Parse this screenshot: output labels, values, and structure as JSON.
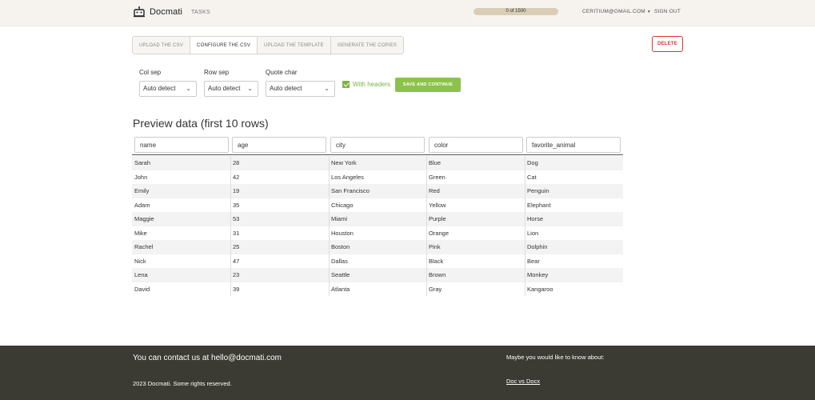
{
  "header": {
    "logo_text": "Docmati",
    "nav_tasks": "TASKS",
    "usage_text": "0 of 1500",
    "usage_fraction": 0,
    "user_email": "CERITIUM@GMAIL.COM",
    "sign_out": "SIGN OUT"
  },
  "tabs": [
    {
      "label": "UPLOAD THE CSV"
    },
    {
      "label": "CONFIGURE THE CSV"
    },
    {
      "label": "UPLOAD THE TEMPLATE"
    },
    {
      "label": "GENERATE THE COPIES"
    }
  ],
  "delete_label": "DELETE",
  "config": {
    "col_sep": {
      "label": "Col sep",
      "value": "Auto detect"
    },
    "row_sep": {
      "label": "Row sep",
      "value": "Auto detect"
    },
    "quote_char": {
      "label": "Quote char",
      "value": "Auto detect"
    },
    "with_headers": "With headers",
    "save_label": "SAVE AND CONTINUE"
  },
  "preview": {
    "title": "Preview data (first 10 rows)",
    "columns": [
      "name",
      "age",
      "city",
      "color",
      "favorite_animal"
    ],
    "rows": [
      [
        "Sarah",
        "28",
        "New York",
        "Blue",
        "Dog"
      ],
      [
        "John",
        "42",
        "Los Angeles",
        "Green",
        "Cat"
      ],
      [
        "Emily",
        "19",
        "San Francisco",
        "Red",
        "Penguin"
      ],
      [
        "Adam",
        "35",
        "Chicago",
        "Yellow",
        "Elephant"
      ],
      [
        "Maggie",
        "53",
        "Miami",
        "Purple",
        "Horse"
      ],
      [
        "Mike",
        "31",
        "Houston",
        "Orange",
        "Lion"
      ],
      [
        "Rachel",
        "25",
        "Boston",
        "Pink",
        "Dolphin"
      ],
      [
        "Nick",
        "47",
        "Dallas",
        "Black",
        "Bear"
      ],
      [
        "Lena",
        "23",
        "Seattle",
        "Brown",
        "Monkey"
      ],
      [
        "David",
        "39",
        "Atlanta",
        "Gray",
        "Kangaroo"
      ]
    ]
  },
  "footer": {
    "contact": "You can contact us at hello@docmati.com",
    "copyright": "2023 Docmati. Some rights reserved.",
    "know_title": "Maybe you would like to know about:",
    "link": "Doc vs Docx"
  },
  "colors": {
    "accent_green": "#8bc34a",
    "danger_red": "#d33333",
    "footer_bg": "#3b3a33",
    "header_bg": "#f6f3ef"
  }
}
